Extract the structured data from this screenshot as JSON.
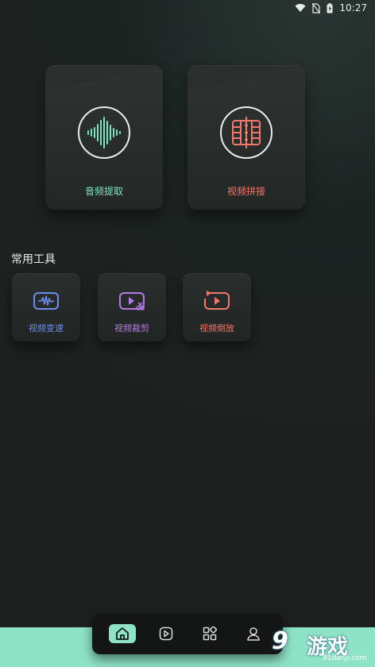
{
  "status_bar": {
    "time": "10:27"
  },
  "cards": [
    {
      "label": "音频提取",
      "color": "#7fe3c3",
      "icon": "waveform-icon"
    },
    {
      "label": "视频拼接",
      "color": "#f2786c",
      "icon": "film-merge-icon"
    }
  ],
  "section": {
    "title": "常用工具"
  },
  "tools": [
    {
      "label": "视频变速",
      "color": "#6b8ff0",
      "icon": "speed-wave-icon"
    },
    {
      "label": "视频裁剪",
      "color": "#b57ae8",
      "icon": "scissors-play-icon"
    },
    {
      "label": "视频倒放",
      "color": "#f2786c",
      "icon": "reverse-play-icon"
    }
  ],
  "nav": {
    "items": [
      {
        "icon": "home-icon",
        "active": true
      },
      {
        "icon": "play-icon",
        "active": false
      },
      {
        "icon": "apps-icon",
        "active": false
      },
      {
        "icon": "profile-icon",
        "active": false
      }
    ],
    "accent": "#8ee3c7"
  },
  "watermark": {
    "number": "9",
    "brand": "游戏",
    "url": "91danji.com"
  }
}
